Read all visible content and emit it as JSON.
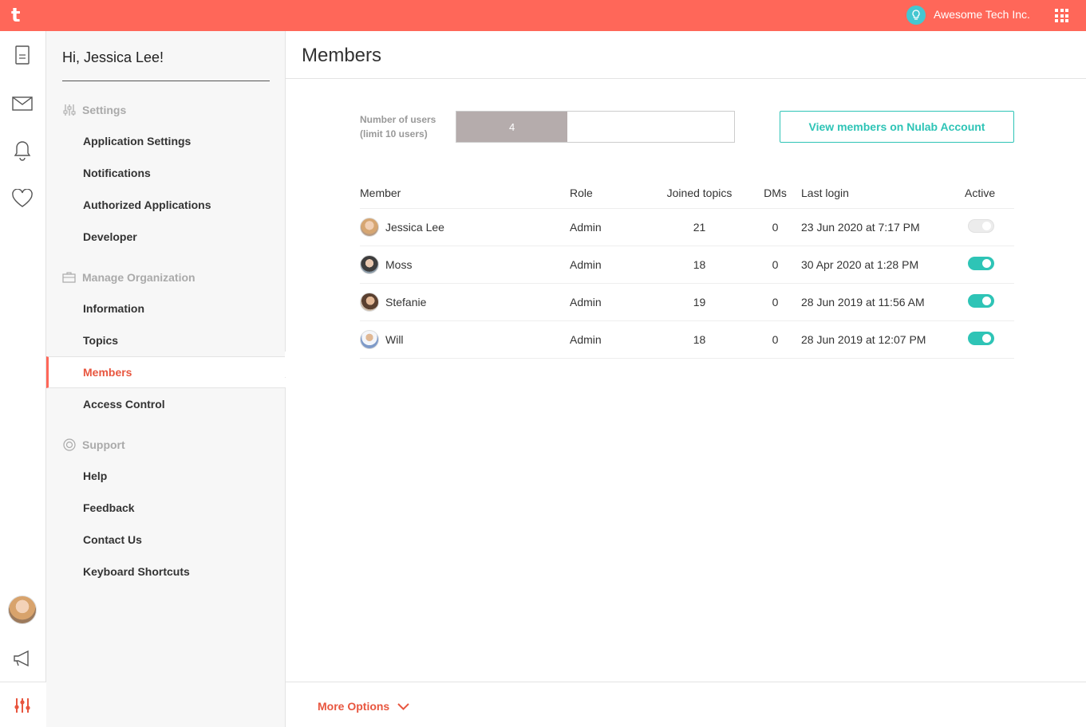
{
  "app": {
    "logo_glyph": "t",
    "accent": "#FF6759",
    "teal": "#2EC4B6"
  },
  "topbar": {
    "org_name": "Awesome Tech Inc."
  },
  "sidebar": {
    "greeting": "Hi, Jessica Lee!",
    "sections": [
      {
        "title": "Settings",
        "icon": "sliders-icon",
        "items": [
          "Application Settings",
          "Notifications",
          "Authorized Applications",
          "Developer"
        ]
      },
      {
        "title": "Manage Organization",
        "icon": "briefcase-icon",
        "items": [
          "Information",
          "Topics",
          "Members",
          "Access Control"
        ]
      },
      {
        "title": "Support",
        "icon": "lifebuoy-icon",
        "items": [
          "Help",
          "Feedback",
          "Contact Us",
          "Keyboard Shortcuts"
        ]
      }
    ],
    "active_item": "Members"
  },
  "main": {
    "title": "Members",
    "users_label_line1": "Number of users",
    "users_label_line2": "(limit 10 users)",
    "user_count": "4",
    "user_limit": 10,
    "view_button": "View members on Nulab Account",
    "columns": [
      "Member",
      "Role",
      "Joined topics",
      "DMs",
      "Last login",
      "Active"
    ],
    "rows": [
      {
        "name": "Jessica Lee",
        "role": "Admin",
        "topics": "21",
        "dms": "0",
        "last_login": "23 Jun 2020 at 7:17 PM",
        "active": false
      },
      {
        "name": "Moss",
        "role": "Admin",
        "topics": "18",
        "dms": "0",
        "last_login": "30 Apr 2020 at 1:28 PM",
        "active": true
      },
      {
        "name": "Stefanie",
        "role": "Admin",
        "topics": "19",
        "dms": "0",
        "last_login": "28 Jun 2019 at 11:56 AM",
        "active": true
      },
      {
        "name": "Will",
        "role": "Admin",
        "topics": "18",
        "dms": "0",
        "last_login": "28 Jun 2019 at 12:07 PM",
        "active": true
      }
    ],
    "more_options": "More Options"
  }
}
